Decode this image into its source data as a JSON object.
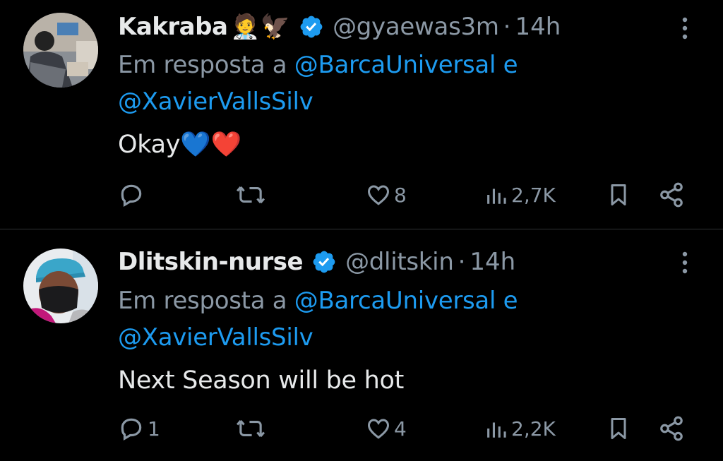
{
  "tweets": [
    {
      "name": "Kakraba",
      "emojis": "🧑‍⚕️🦅",
      "handle": "@gyaewas3m",
      "separator": "·",
      "time": "14h",
      "reply_prefix": "Em resposta a",
      "mention_1": "@BarcaUniversal",
      "conjunction": "e",
      "mention_2": "@XavierVallsSilv",
      "text": "Okay",
      "text_emojis": "💙❤️",
      "reply_count": "",
      "retweet_count": "",
      "like_count": "8",
      "view_count": "2,7K"
    },
    {
      "name": "Dlitskin-nurse",
      "handle": "@dlitskin",
      "separator": "·",
      "time": "14h",
      "reply_prefix": "Em resposta a",
      "mention_1": "@BarcaUniversal",
      "conjunction": "e",
      "mention_2": "@XavierVallsSilv",
      "text": "Next Season will be hot",
      "reply_count": "1",
      "retweet_count": "",
      "like_count": "4",
      "view_count": "2,2K"
    }
  ],
  "colors": {
    "background": "#000000",
    "text": "#e7e9ea",
    "muted": "#8b98a5",
    "link": "#1d9bf0",
    "verified": "#1d9bf0",
    "divider": "#2f3336"
  },
  "icons": {
    "reply": "reply-icon",
    "retweet": "retweet-icon",
    "like": "like-icon",
    "views": "views-icon",
    "bookmark": "bookmark-icon",
    "share": "share-icon",
    "more": "more-vertical-icon",
    "verified": "verified-badge-icon"
  }
}
